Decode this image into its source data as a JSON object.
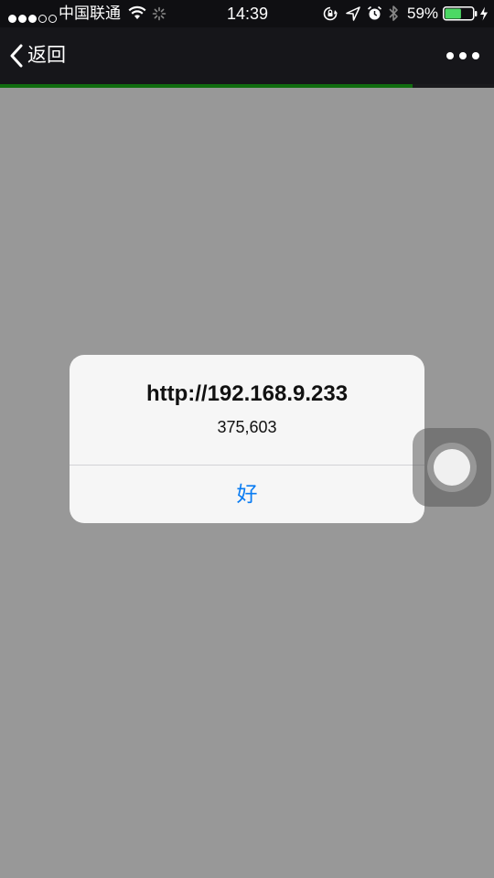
{
  "status_bar": {
    "carrier": "中国联通",
    "time": "14:39",
    "battery_percent": "59%",
    "battery_level": 0.59,
    "signal_bars_filled": 3,
    "signal_bars_total": 5
  },
  "nav": {
    "back_label": "返回",
    "page_load_progress": 0.835
  },
  "alert": {
    "title": "http://192.168.9.233",
    "message": "375,603",
    "ok_label": "好"
  },
  "colors": {
    "accent_blue": "#0a7cf2",
    "progress_green": "#1aad19",
    "battery_green": "#4cd964"
  }
}
